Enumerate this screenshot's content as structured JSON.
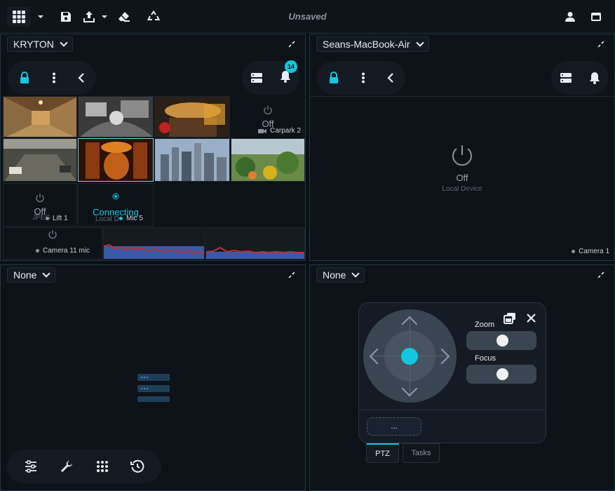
{
  "topbar": {
    "status": "Unsaved",
    "icons": [
      "grid-icon",
      "chevron-down-icon",
      "save-icon",
      "upload-icon",
      "chevron-down-icon",
      "eraser-icon",
      "recycle-icon",
      "user-icon",
      "window-icon"
    ]
  },
  "panes": {
    "top_left": {
      "select": "KRYTON",
      "notifications_count": "14",
      "cells": [
        {
          "label": "Off",
          "name": "Carpark 2"
        },
        {
          "label": "Off",
          "sub": "JPEG",
          "name": "Lift 1"
        },
        {
          "label": "Connecting",
          "sub": "Local D",
          "name": "Mic 5"
        },
        {
          "label": "Off",
          "name": "Camera 11 mic"
        }
      ]
    },
    "top_right": {
      "select": "Seans-MacBook-Air",
      "status": "Off",
      "sub": "Local Device",
      "camera": "Camera 1"
    },
    "bottom_left": {
      "select": "None"
    },
    "bottom_right": {
      "select": "None",
      "ptz": {
        "zoom_label": "Zoom",
        "focus_label": "Focus",
        "preset_label": "...",
        "tabs": [
          "PTZ",
          "Tasks"
        ]
      }
    }
  },
  "colors": {
    "accent": "#11c8e0",
    "background": "#0b0f15",
    "pane_border": "#1b3a40"
  }
}
